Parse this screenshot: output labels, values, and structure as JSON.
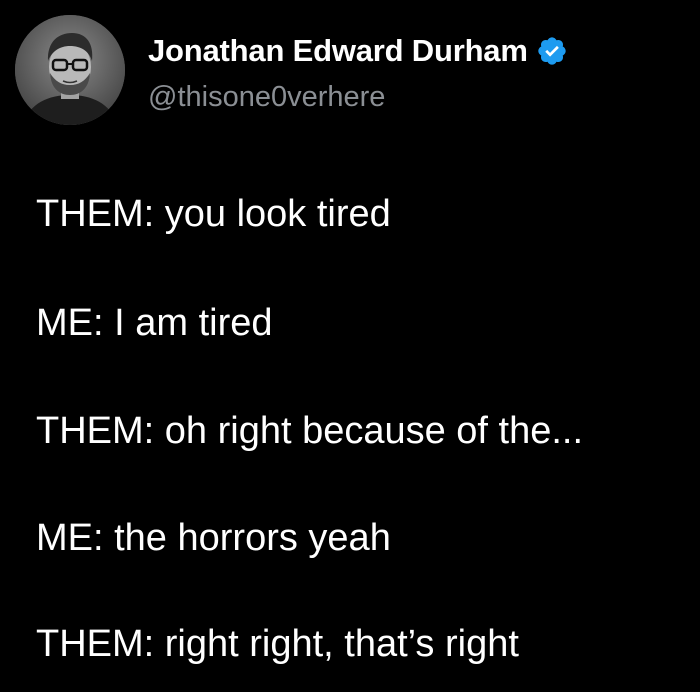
{
  "author": {
    "display_name": "Jonathan Edward Durham",
    "handle": "@thisone0verhere",
    "verified": true,
    "verified_color": "#1d9bf0",
    "avatar_icon": "profile-photo"
  },
  "tweet": {
    "lines": [
      "THEM: you look tired",
      "ME: I am tired",
      "THEM: oh right because of the...",
      "ME: the horrors yeah",
      "THEM: right right, that’s right"
    ]
  },
  "colors": {
    "background": "#000000",
    "text": "#ffffff",
    "handle": "#8b8f94"
  }
}
